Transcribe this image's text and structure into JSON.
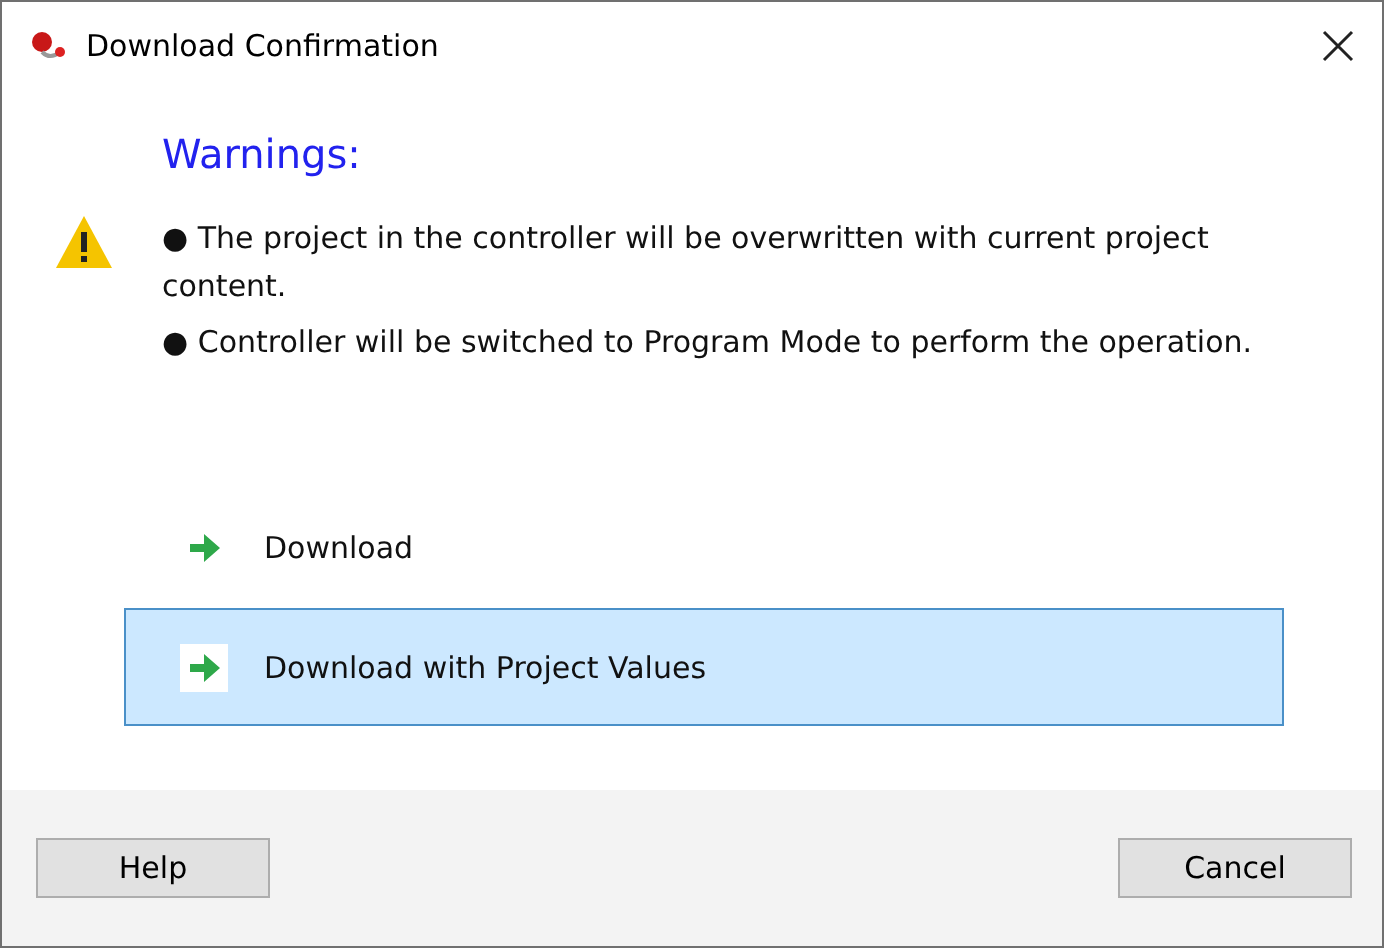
{
  "window": {
    "title": "Download Confirmation"
  },
  "heading": "Warnings:",
  "warnings": [
    "● The project in the controller will be overwritten with current project content.",
    "● Controller will be switched to Program Mode to perform the operation."
  ],
  "options": [
    {
      "label": "Download",
      "selected": false
    },
    {
      "label": "Download with Project Values",
      "selected": true
    }
  ],
  "buttons": {
    "left": "Help",
    "right": "Cancel"
  }
}
